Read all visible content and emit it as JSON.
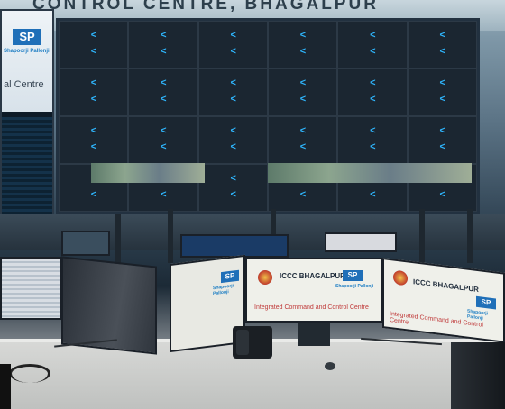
{
  "wall_sign": {
    "text": "CONTROL CENTRE, BHAGALPUR"
  },
  "left_screen": {
    "logo_text": "SP",
    "brand": "Shapoorji Pallonji",
    "caption": "al Centre"
  },
  "video_wall": {
    "arrow_glyph": "<"
  },
  "monitor_left_mid": {
    "logo_text": "SP",
    "brand": "Shapoorji Pallonji"
  },
  "monitor_center": {
    "title": "ICCC BHAGALPUR",
    "logo_text": "SP",
    "brand": "Shapoorji Pallonji",
    "tagline": "Integrated Command and Control Centre"
  },
  "monitor_right": {
    "title": "ICCC BHAGALPUR",
    "logo_text": "SP",
    "brand": "Shapoorji Pallonji",
    "tagline": "Integrated Command and Control Centre"
  },
  "colors": {
    "accent_blue": "#2fb7ff",
    "brand_blue": "#1f7fc4",
    "wall_bg": "#0f1922"
  }
}
